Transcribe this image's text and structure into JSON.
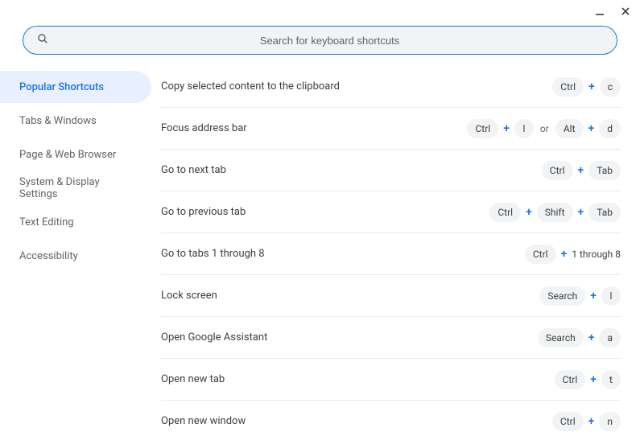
{
  "search": {
    "placeholder": "Search for keyboard shortcuts"
  },
  "sidebar": {
    "items": [
      {
        "label": "Popular Shortcuts",
        "active": true
      },
      {
        "label": "Tabs & Windows",
        "active": false
      },
      {
        "label": "Page & Web Browser",
        "active": false
      },
      {
        "label": "System & Display Settings",
        "active": false
      },
      {
        "label": "Text Editing",
        "active": false
      },
      {
        "label": "Accessibility",
        "active": false
      }
    ]
  },
  "shortcuts": [
    {
      "label": "Copy selected content to the clipboard",
      "combos": [
        [
          "Ctrl",
          "+",
          "c"
        ]
      ]
    },
    {
      "label": "Focus address bar",
      "combos": [
        [
          "Ctrl",
          "+",
          "l"
        ],
        "or",
        [
          "Alt",
          "+",
          "d"
        ]
      ]
    },
    {
      "label": "Go to next tab",
      "combos": [
        [
          "Ctrl",
          "+",
          "Tab"
        ]
      ]
    },
    {
      "label": "Go to previous tab",
      "combos": [
        [
          "Ctrl",
          "+",
          "Shift",
          "+",
          "Tab"
        ]
      ]
    },
    {
      "label": "Go to tabs 1 through 8",
      "combos": [
        [
          "Ctrl",
          "+",
          "#1 through 8"
        ]
      ]
    },
    {
      "label": "Lock screen",
      "combos": [
        [
          "Search",
          "+",
          "l"
        ]
      ]
    },
    {
      "label": "Open Google Assistant",
      "combos": [
        [
          "Search",
          "+",
          "a"
        ]
      ]
    },
    {
      "label": "Open new tab",
      "combos": [
        [
          "Ctrl",
          "+",
          "t"
        ]
      ]
    },
    {
      "label": "Open new window",
      "combos": [
        [
          "Ctrl",
          "+",
          "n"
        ]
      ]
    }
  ]
}
